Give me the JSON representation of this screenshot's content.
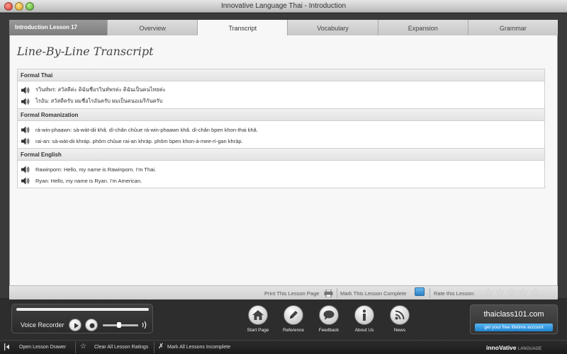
{
  "window": {
    "title": "Innovative Language Thai - Introduction"
  },
  "tabs": {
    "lesson_label": "Introduction Lesson 17",
    "items": [
      {
        "label": "Overview"
      },
      {
        "label": "Transcript"
      },
      {
        "label": "Vocabulary"
      },
      {
        "label": "Expansion"
      },
      {
        "label": "Grammar"
      }
    ],
    "active": "Transcript"
  },
  "page": {
    "heading": "Line-By-Line Transcript"
  },
  "transcript": {
    "sections": [
      {
        "title": "Formal Thai",
        "lines": [
          "รวินท์พร: สวัสดีค่ะ ดิฉันชื่อรวินท์พรค่ะ ดิฉันเป็นคนไทยค่ะ",
          "ไรอัน: สวัสดีครับ ผมชื่อไรอันครับ ผมเป็นคนอเมริกันครับ"
        ]
      },
      {
        "title": "Formal Romanization",
        "lines": [
          "rá-win-phaawn: sà-wàt-dii khâ. dì-chǎn chûue rá-win-phaawn khâ. dì-chǎn bpen khon-thai khâ.",
          "rai-an: sà-wàt-dii khráp. phǒm chûue rai-an khráp. phǒm bpen khon-à-mee-rí-gan khráp."
        ]
      },
      {
        "title": "Formal English",
        "lines": [
          "Rawinporn: Hello, my name is Rawinporn. I'm Thai.",
          "Ryan: Hello, my name is Ryan. I'm American."
        ]
      }
    ]
  },
  "footer": {
    "print_label": "Print This Lesson Page",
    "complete_label": "Mark This Lesson Complete",
    "rate_label": "Rate this Lesson:",
    "rating": 0,
    "rating_max": 5
  },
  "recorder": {
    "label": "Voice Recorder",
    "volume_level": 0.45
  },
  "nav": [
    {
      "label": "Start Page",
      "icon": "home-icon"
    },
    {
      "label": "Reference",
      "icon": "pen-icon"
    },
    {
      "label": "Feedback",
      "icon": "speech-bubble-icon"
    },
    {
      "label": "About Us",
      "icon": "info-icon"
    },
    {
      "label": "News",
      "icon": "rss-icon"
    }
  ],
  "promo": {
    "site": "thaiclass101.com",
    "button": "get your free lifetime account"
  },
  "statusbar": {
    "open_drawer": "Open Lesson Drawer",
    "clear_ratings": "Clear All Lesson Ratings",
    "mark_incomplete": "Mark All Lessons Incomplete",
    "brand": "innoVative",
    "brand_sub": "LANGUAGE"
  },
  "colors": {
    "accent_blue": "#2a7fc5",
    "panel_bg": "#f7f7f7",
    "frame_bg": "#3a3a3a"
  }
}
